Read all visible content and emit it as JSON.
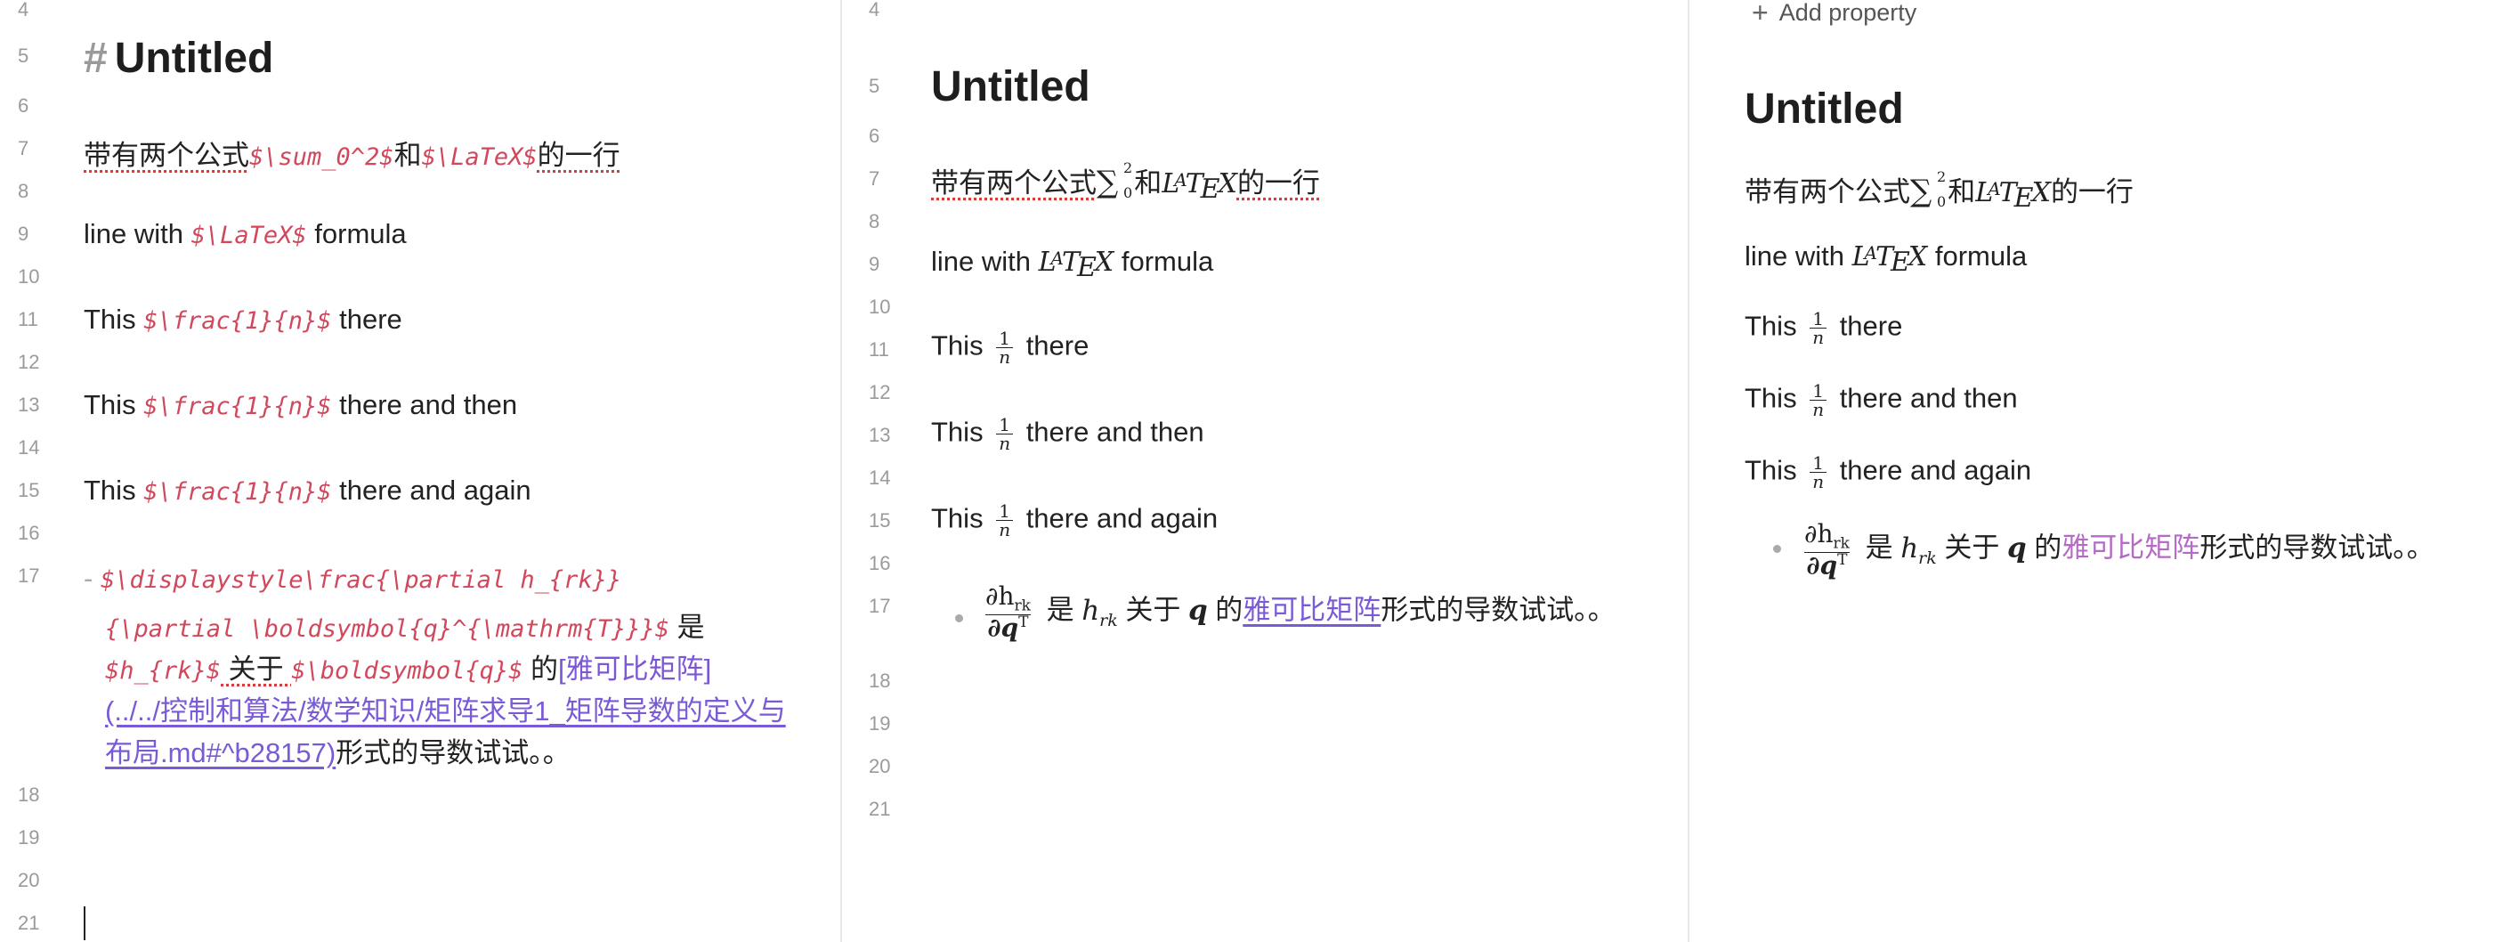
{
  "left_pane": {
    "line_numbers": [
      "4",
      "5",
      "6",
      "7",
      "8",
      "9",
      "10",
      "11",
      "12",
      "13",
      "14",
      "15",
      "16",
      "17",
      "18",
      "19",
      "20",
      "21"
    ],
    "heading_hash": "#",
    "title": "Untitled",
    "line7": {
      "prefix": "带有两个公式",
      "math1": "$\\sum_0^2$",
      "mid": "和",
      "math2": "$\\LaTeX$",
      "suffix": "的一行"
    },
    "line9": {
      "prefix": "line with ",
      "math": "$\\LaTeX$",
      "suffix": " formula"
    },
    "line11": {
      "prefix": "This ",
      "math": "$\\frac{1}{n}$",
      "suffix": " there"
    },
    "line13": {
      "prefix": "This ",
      "math": "$\\frac{1}{n}$",
      "suffix": " there and then"
    },
    "line15": {
      "prefix": "This ",
      "math": "$\\frac{1}{n}$",
      "suffix": " there and again"
    },
    "line17": {
      "dash": "-",
      "row1": "$\\displaystyle\\frac{\\partial h_{rk}}",
      "row2": "{\\partial \\boldsymbol{q}^{\\mathrm{T}}}$",
      "row2_suffix": " 是",
      "row3_math1": "$h_{rk}$",
      "row3_mid1": " 关于 ",
      "row3_math2": "$\\boldsymbol{q}$",
      "row3_mid2": " 的",
      "row3_link_text": "[雅可比矩阵]",
      "row4_link": "(../../控制和算法/数学知识/矩阵求导1_矩阵导数的定义与",
      "row5_link": "布局.md#^b28157)",
      "row5_suffix": "形式的导数试试。。"
    }
  },
  "middle_pane": {
    "line_numbers": [
      "4",
      "5",
      "6",
      "7",
      "8",
      "9",
      "10",
      "11",
      "12",
      "13",
      "14",
      "15",
      "16",
      "17",
      "18",
      "19",
      "20",
      "21"
    ],
    "title": "Untitled",
    "line7": {
      "prefix": "带有两个公式",
      "mid": "和",
      "suffix": "的一行"
    },
    "line9": {
      "prefix": "line with ",
      "suffix": " formula"
    },
    "line11": {
      "prefix": "This ",
      "suffix": " there"
    },
    "line13": {
      "prefix": "This ",
      "suffix": " there and then"
    },
    "line15": {
      "prefix": "This ",
      "suffix": " there and again"
    },
    "line17": {
      "mid1": " 是 ",
      "mid2": " 关于 ",
      "mid3": " 的",
      "link": "雅可比矩阵",
      "suffix": "形式的导数试试。。"
    }
  },
  "right_pane": {
    "add_property": "Add property",
    "title": "Untitled",
    "line7": {
      "prefix": "带有两个公式",
      "mid": "和",
      "suffix": "的一行"
    },
    "line9": {
      "prefix": "line with ",
      "suffix": " formula"
    },
    "line11": {
      "prefix": "This ",
      "suffix": " there"
    },
    "line13": {
      "prefix": "This ",
      "suffix": " there and then"
    },
    "line15": {
      "prefix": "This ",
      "suffix": " there and again"
    },
    "line17": {
      "mid1": " 是 ",
      "mid2": " 关于 ",
      "mid3": " 的",
      "link": "雅可比矩阵",
      "suffix": "形式的导数试试。。"
    }
  },
  "math_glyphs": {
    "latex_L": "L",
    "latex_A": "A",
    "latex_T": "T",
    "latex_E": "E",
    "latex_X": "X",
    "sum": "∑",
    "sum_sup": "2",
    "sum_sub": "0",
    "frac_num": "1",
    "frac_den": "n",
    "partial_num": "∂h",
    "partial_num_sub": "rk",
    "partial_den": "∂q",
    "partial_den_sup": "T",
    "h": "h",
    "h_sub": "rk",
    "q": "q"
  },
  "colors": {
    "dollar": "#7d56d6",
    "command": "#d1485c",
    "argument": "#2f8f8f",
    "link": "#7a5ad6",
    "link_reading": "#b36bc4"
  }
}
